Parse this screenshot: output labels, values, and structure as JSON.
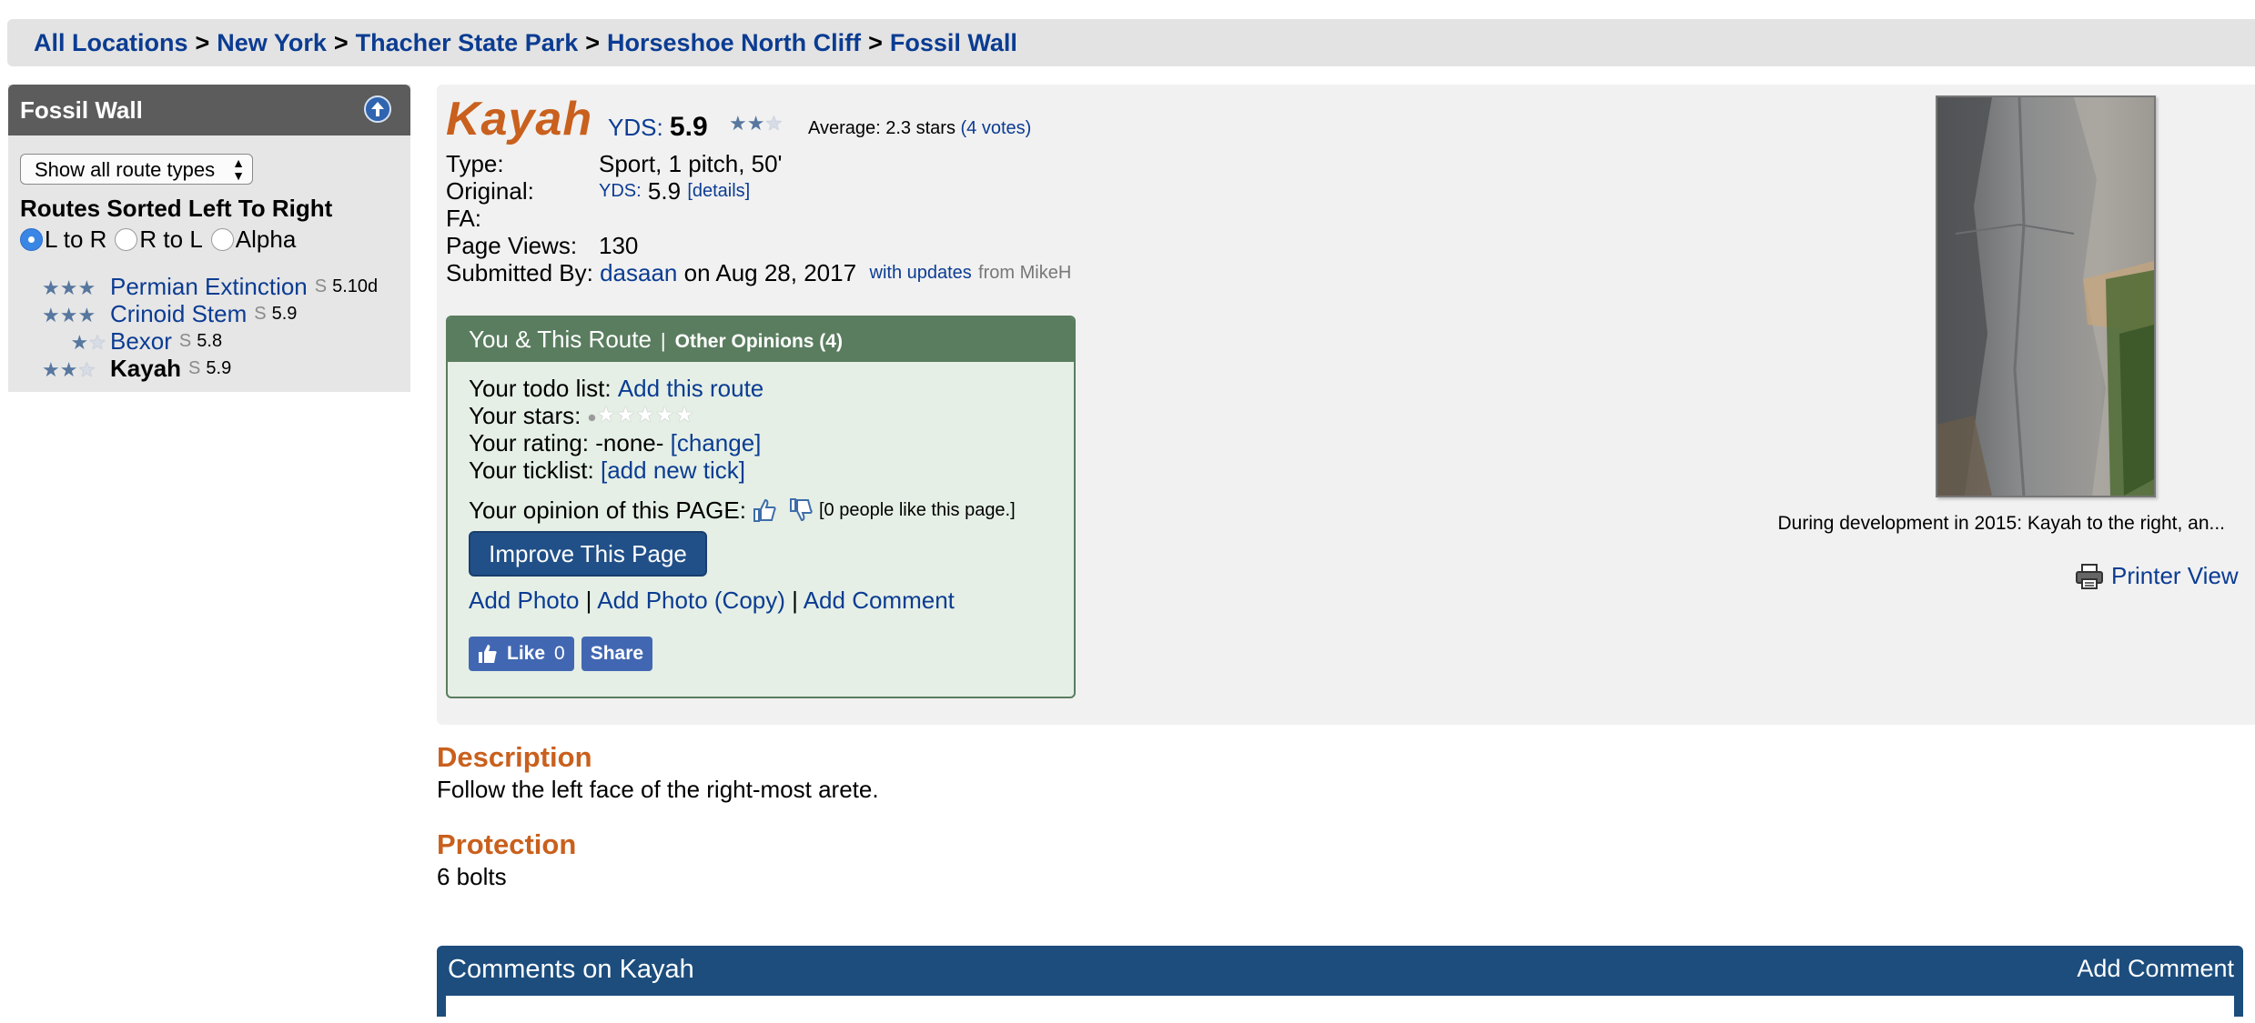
{
  "breadcrumb": [
    {
      "label": "All Locations"
    },
    {
      "label": "New York"
    },
    {
      "label": "Thacher State Park"
    },
    {
      "label": "Horseshoe North Cliff"
    },
    {
      "label": "Fossil Wall"
    }
  ],
  "breadcrumb_separator": ">",
  "sidebar": {
    "title": "Fossil Wall",
    "route_type_select": "Show all route types",
    "sort_title": "Routes Sorted Left To Right",
    "sort_options": [
      "L to R",
      "R to L",
      "Alpha"
    ],
    "sort_selected": "L to R",
    "routes": [
      {
        "name": "Permian Extinction",
        "type": "S",
        "grade": "5.10d",
        "stars": 3
      },
      {
        "name": "Crinoid Stem",
        "type": "S",
        "grade": "5.9",
        "stars": 3
      },
      {
        "name": "Bexor",
        "type": "S",
        "grade": "5.8",
        "stars": 2
      },
      {
        "name": "Kayah",
        "type": "S",
        "grade": "5.9",
        "stars": 2.3
      }
    ]
  },
  "route": {
    "name": "Kayah",
    "grade_system": "YDS:",
    "grade": "5.9",
    "avg_stars": 2.3,
    "avg_text": "Average: 2.3 stars",
    "votes": "(4 votes)",
    "type_label": "Type:",
    "type_value": "Sport, 1 pitch, 50'",
    "original_label": "Original:",
    "original_system": "YDS:",
    "original_grade": "5.9",
    "original_details": "[details]",
    "fa_label": "FA:",
    "page_views_label": "Page Views:",
    "page_views": "130",
    "submitted_label": "Submitted By:",
    "submitted_user": "dasaan",
    "submitted_date": "on Aug 28, 2017",
    "with_updates": "with updates",
    "from_user": "from MikeH"
  },
  "you_box": {
    "title": "You & This Route",
    "separator": "|",
    "other_opinions": "Other Opinions (4)",
    "todo_label": "Your todo list:",
    "todo_link": "Add this route",
    "stars_label": "Your stars:",
    "rating_label": "Your rating:",
    "rating_value": "-none-",
    "rating_change": "[change]",
    "ticklist_label": "Your ticklist:",
    "ticklist_link": "[add new tick]",
    "opinion_label": "Your opinion of this PAGE:",
    "opinion_count": "[0 people like this page.]",
    "improve_button": "Improve This Page",
    "add_photo": "Add Photo",
    "add_photo_copy": "Add Photo (Copy)",
    "add_comment": "Add Comment",
    "link_sep": "|",
    "fb_like": "Like",
    "fb_like_count": "0",
    "fb_share": "Share"
  },
  "photo": {
    "caption": "During development in 2015: Kayah to the right, an..."
  },
  "printer_view": "Printer View",
  "description": {
    "title": "Description",
    "text": "Follow the left face of the right-most arete."
  },
  "protection": {
    "title": "Protection",
    "text": "6 bolts"
  },
  "comments": {
    "title": "Comments on Kayah",
    "add": "Add Comment"
  },
  "colors": {
    "accent_orange": "#c9601d",
    "link_blue": "#0b3c92",
    "you_box_green": "#5a7d5f",
    "comments_blue": "#1c4d7d"
  }
}
